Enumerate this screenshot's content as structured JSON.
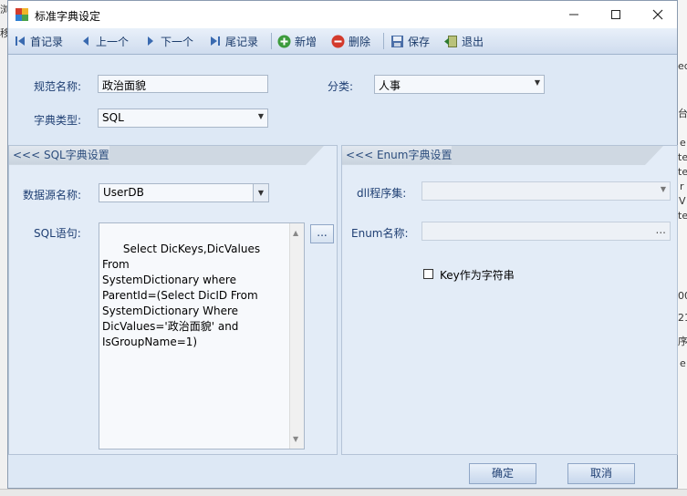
{
  "window": {
    "title": "标准字典设定"
  },
  "toolbar": {
    "first": "首记录",
    "prev": "上一个",
    "next": "下一个",
    "last": "尾记录",
    "add": "新增",
    "delete": "删除",
    "save": "保存",
    "exit": "退出"
  },
  "form": {
    "name_label": "规范名称:",
    "name_value": "政治面貌",
    "category_label": "分类:",
    "category_value": "人事",
    "dict_type_label": "字典类型:",
    "dict_type_value": "SQL"
  },
  "sql_panel": {
    "header": "<<< SQL字典设置",
    "datasource_label": "数据源名称:",
    "datasource_value": "UserDB",
    "sql_label": "SQL语句:",
    "sql_text": "Select DicKeys,DicValues From\nSystemDictionary where\nParentId=(Select DicID From\nSystemDictionary Where\nDicValues='政治面貌' and\nIsGroupName=1)",
    "ellipsis": "..."
  },
  "enum_panel": {
    "header": "<<< Enum字典设置",
    "dll_label": "dll程序集:",
    "dll_value": "",
    "enum_label": "Enum名称:",
    "enum_value": "",
    "enum_ellipsis": "...",
    "key_as_string_label": "Key作为字符串",
    "key_as_string_checked": false
  },
  "buttons": {
    "ok": "确定",
    "cancel": "取消"
  },
  "background_fragments": [
    "浏",
    "移",
    "ed",
    "台",
    "e",
    "te",
    "te",
    "r",
    "V",
    "te",
    "00",
    "21",
    "序",
    "e"
  ]
}
